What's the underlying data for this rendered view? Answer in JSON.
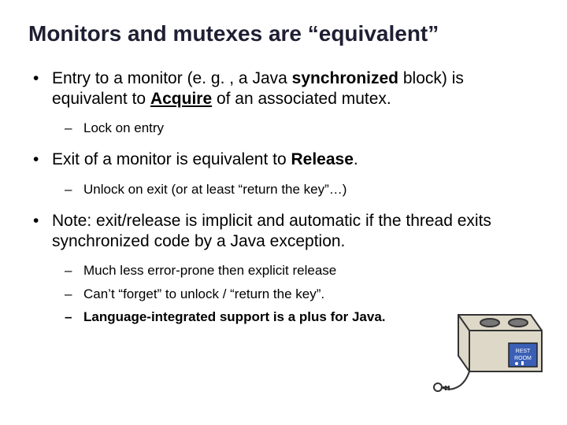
{
  "title": "Monitors and mutexes are “equivalent”",
  "bullets": {
    "b1": {
      "t1": "Entry to a monitor (e. g. , a Java ",
      "t2": "synchronized",
      "t3": " block) is equivalent to ",
      "t4": "Acquire",
      "t5": " of an associated mutex.",
      "sub": {
        "s1": "Lock on entry"
      }
    },
    "b2": {
      "t1": "Exit of a monitor is equivalent to ",
      "t2": "Release",
      "t3": ".",
      "sub": {
        "s1": "Unlock on exit (or at least “return the key”…)"
      }
    },
    "b3": {
      "t1": "Note: exit/release is implicit and automatic if the thread exits synchronized code by a Java exception.",
      "sub": {
        "s1": "Much less error-prone then explicit release",
        "s2": "Can’t “forget” to unlock / “return the key”.",
        "s3": "Language-integrated support is a plus for Java."
      }
    }
  }
}
